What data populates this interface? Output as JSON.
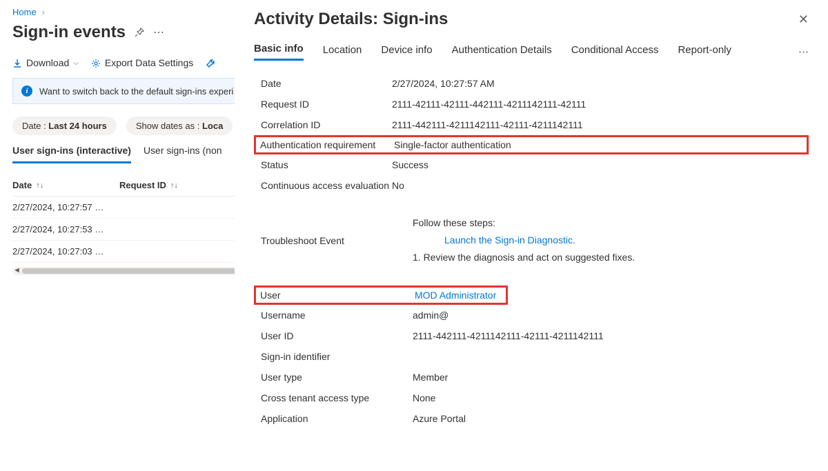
{
  "breadcrumb": {
    "home": "Home"
  },
  "page_title": "Sign-in events",
  "toolbar": {
    "download": "Download",
    "export": "Export Data Settings"
  },
  "banner": {
    "text": "Want to switch back to the default sign-ins experi"
  },
  "filters": {
    "date_label": "Date : ",
    "date_value": "Last 24 hours",
    "show_label": "Show dates as : ",
    "show_value": "Loca"
  },
  "sub_tabs": {
    "interactive": "User sign-ins (interactive)",
    "noninteractive": "User sign-ins (non"
  },
  "table": {
    "col_date": "Date",
    "col_request": "Request ID",
    "rows": [
      {
        "date": "2/27/2024, 10:27:57 …"
      },
      {
        "date": "2/27/2024, 10:27:53 …"
      },
      {
        "date": "2/27/2024, 10:27:03 …"
      }
    ]
  },
  "detail": {
    "title": "Activity Details: Sign-ins",
    "tabs": {
      "basic": "Basic info",
      "location": "Location",
      "device": "Device info",
      "auth": "Authentication Details",
      "ca": "Conditional Access",
      "report": "Report-only"
    },
    "basic": {
      "date_k": "Date",
      "date_v": "2/27/2024, 10:27:57 AM",
      "request_k": "Request ID",
      "request_v": "2111-42111-42111-442111-4211142111-42111",
      "correlation_k": "Correlation ID",
      "correlation_v": "2111-442111-4211142111-42111-4211142111",
      "authreq_k": "Authentication requirement",
      "authreq_v": "Single-factor authentication",
      "status_k": "Status",
      "status_v": "Success",
      "cae_k": "Continuous access evaluation",
      "cae_v": "No",
      "troubleshoot_k": "Troubleshoot Event",
      "troubleshoot_intro": "Follow these steps:",
      "troubleshoot_link": "Launch the Sign-in Diagnostic.",
      "troubleshoot_step1": "1. Review the diagnosis and act on suggested fixes.",
      "user_k": "User",
      "user_v": "MOD Administrator",
      "username_k": "Username",
      "username_v": "admin@",
      "userid_k": "User ID",
      "userid_v": "2111-442111-4211142111-42111-4211142111",
      "signinid_k": "Sign-in identifier",
      "signinid_v": "",
      "usertype_k": "User type",
      "usertype_v": "Member",
      "ctat_k": "Cross tenant access type",
      "ctat_v": "None",
      "app_k": "Application",
      "app_v": "Azure Portal"
    }
  }
}
